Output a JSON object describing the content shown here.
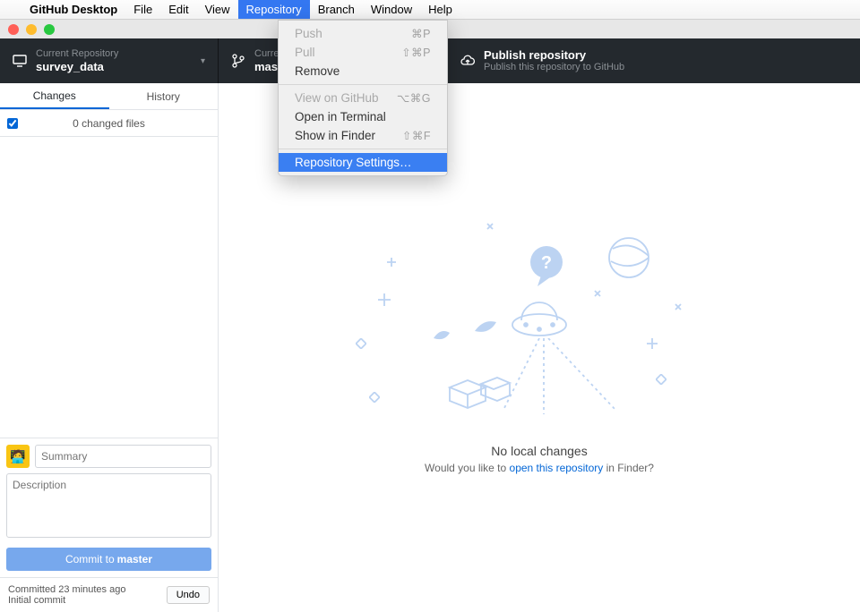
{
  "menubar": {
    "app": "GitHub Desktop",
    "items": [
      "File",
      "Edit",
      "View",
      "Repository",
      "Branch",
      "Window",
      "Help"
    ],
    "active_index": 3
  },
  "dropdown": {
    "groups": [
      [
        {
          "label": "Push",
          "shortcut": "⌘P",
          "disabled": true
        },
        {
          "label": "Pull",
          "shortcut": "⇧⌘P",
          "disabled": true
        },
        {
          "label": "Remove",
          "shortcut": "",
          "disabled": false
        }
      ],
      [
        {
          "label": "View on GitHub",
          "shortcut": "⌥⌘G",
          "disabled": true
        },
        {
          "label": "Open in Terminal",
          "shortcut": "",
          "disabled": false
        },
        {
          "label": "Show in Finder",
          "shortcut": "⇧⌘F",
          "disabled": false
        }
      ],
      [
        {
          "label": "Repository Settings…",
          "shortcut": "",
          "disabled": false,
          "selected": true
        }
      ]
    ]
  },
  "toolbar": {
    "repo": {
      "label": "Current Repository",
      "value": "survey_data"
    },
    "branch": {
      "label": "Current Branch",
      "value": "master"
    },
    "publish": {
      "title": "Publish repository",
      "sub": "Publish this repository to GitHub"
    }
  },
  "sidebar": {
    "tab_changes": "Changes",
    "tab_history": "History",
    "changed_files": "0 changed files",
    "summary_placeholder": "Summary",
    "description_placeholder": "Description",
    "commit_prefix": "Commit to ",
    "commit_branch": "master",
    "last_commit_time": "Committed 23 minutes ago",
    "last_commit_msg": "Initial commit",
    "undo": "Undo"
  },
  "empty": {
    "title": "No local changes",
    "sub_before": "Would you like to ",
    "link": "open this repository",
    "sub_after": " in Finder?"
  }
}
